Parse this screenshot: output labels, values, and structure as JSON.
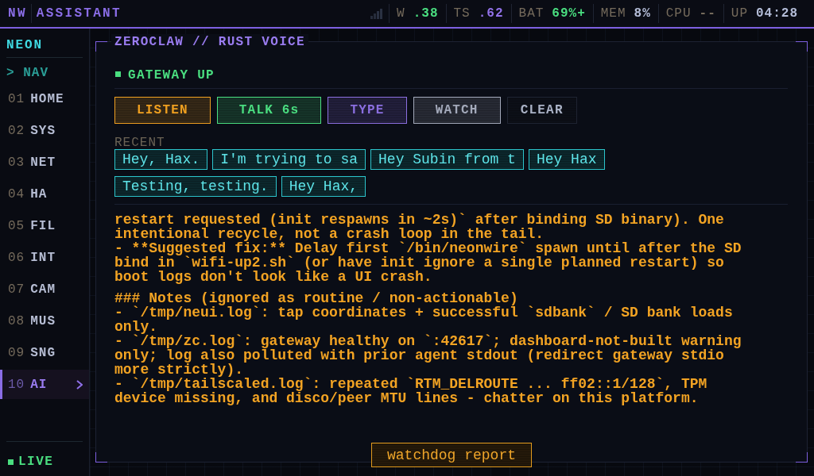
{
  "top_bar": {
    "brand": "NW",
    "title": "ASSISTANT",
    "stats": [
      {
        "label": "W",
        "value": ".38",
        "color": "#4ade80"
      },
      {
        "label": "TS",
        "value": ".62",
        "color": "#9272ea"
      },
      {
        "label": "BAT",
        "value": "69%+",
        "color": "#4ade80"
      },
      {
        "label": "MEM",
        "value": "8%",
        "color": "#b4bdd8"
      },
      {
        "label": "CPU",
        "value": "--",
        "color": "#756b5c"
      },
      {
        "label": "UP",
        "value": "04:28",
        "color": "#b4bdd8"
      }
    ]
  },
  "sidebar": {
    "title": "NEON",
    "section": "> NAV",
    "items": [
      {
        "number": "01",
        "label": "HOME",
        "selected": false
      },
      {
        "number": "02",
        "label": "SYS",
        "selected": false
      },
      {
        "number": "03",
        "label": "NET",
        "selected": false
      },
      {
        "number": "04",
        "label": "HA",
        "selected": false
      },
      {
        "number": "05",
        "label": "FIL",
        "selected": false
      },
      {
        "number": "06",
        "label": "INT",
        "selected": false
      },
      {
        "number": "07",
        "label": "CAM",
        "selected": false
      },
      {
        "number": "08",
        "label": "MUS",
        "selected": false
      },
      {
        "number": "09",
        "label": "SNG",
        "selected": false
      },
      {
        "number": "10",
        "label": "AI",
        "selected": true
      }
    ],
    "status": "LIVE"
  },
  "panel": {
    "title": "ZEROCLAW // RUST VOICE",
    "status": "GATEWAY UP",
    "buttons": [
      {
        "label": "LISTEN",
        "kind": "filled",
        "color": "#f0a020"
      },
      {
        "label": "TALK 6s",
        "kind": "filled",
        "color": "#4ade80"
      },
      {
        "label": "TYPE",
        "kind": "filled",
        "color": "#8b6fe0"
      },
      {
        "label": "WATCH",
        "kind": "filled",
        "color": "#a3a9ba"
      },
      {
        "label": "CLEAR",
        "kind": "ghost",
        "color": "#aab2c6"
      }
    ],
    "recent_label": "RECENT",
    "recent": [
      "Hey, Hax.",
      "I'm trying to sa",
      "Hey Subin from t",
      "Hey Hax",
      "Testing, testing.",
      "Hey Hax,"
    ],
    "log": [
      [
        "restart requested (init respawns in ~2s)` after binding SD binary). One intentional recycle, not a crash loop in the tail.",
        "- **Suggested fix:** Delay first `/bin/neonwire` spawn until after the SD bind in `wifi-up2.sh` (or have init ignore a single planned restart) so boot logs don't look like a UI crash."
      ],
      [
        "### Notes (ignored as routine / non-actionable)",
        "- `/tmp/neui.log`: tap coordinates + successful `sdbank` / SD bank loads only.",
        "- `/tmp/zc.log`: gateway healthy on `:42617`; dashboard-not-built warning only; log also polluted with prior agent stdout (redirect gateway stdio more strictly).",
        "- `/tmp/tailscaled.log`: repeated `RTM_DELROUTE ... ff02::1/128`, TPM device missing, and disco/peer MTU lines - chatter on this platform."
      ]
    ],
    "footer_button": "watchdog report"
  }
}
